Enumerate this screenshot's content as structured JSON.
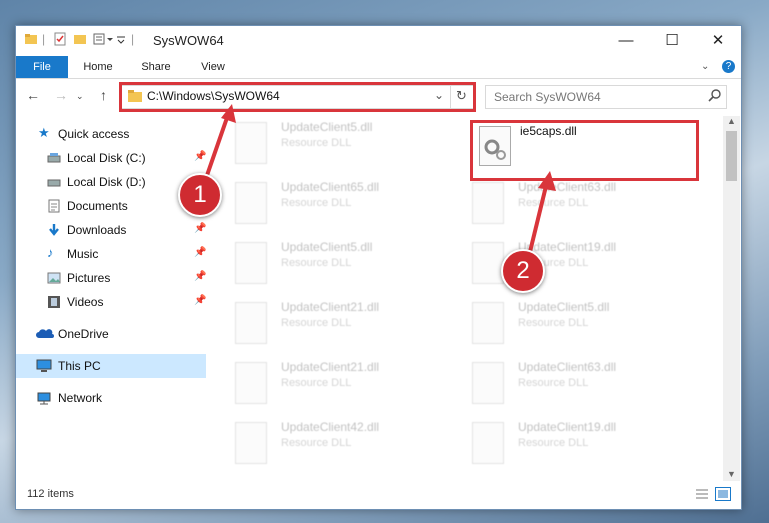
{
  "window": {
    "title": "SysWOW64"
  },
  "ribbon": {
    "tabs": [
      {
        "label": "File"
      },
      {
        "label": "Home"
      },
      {
        "label": "Share"
      },
      {
        "label": "View"
      }
    ]
  },
  "address": {
    "path": "C:\\Windows\\SysWOW64"
  },
  "search": {
    "placeholder": "Search SysWOW64"
  },
  "nav": {
    "items": [
      {
        "label": "Quick access"
      },
      {
        "label": "Local Disk (C:)"
      },
      {
        "label": "Local Disk (D:)"
      },
      {
        "label": "Documents"
      },
      {
        "label": "Downloads"
      },
      {
        "label": "Music"
      },
      {
        "label": "Pictures"
      },
      {
        "label": "Videos"
      },
      {
        "label": "OneDrive"
      },
      {
        "label": "This PC"
      },
      {
        "label": "Network"
      }
    ]
  },
  "files": {
    "left": [
      {
        "name": "UpdateClient5.dll",
        "type": "Resource DLL"
      },
      {
        "name": "UpdateClient65.dll",
        "type": "Resource DLL"
      },
      {
        "name": "UpdateClient5.dll",
        "type": "Resource DLL"
      },
      {
        "name": "UpdateClient21.dll",
        "type": "Resource DLL"
      },
      {
        "name": "UpdateClient21.dll",
        "type": "Resource DLL"
      },
      {
        "name": "UpdateClient42.dll",
        "type": "Resource DLL"
      }
    ],
    "right_highlight": {
      "name": "ie5caps.dll"
    },
    "right": [
      {
        "name": "UpdateClient63.dll",
        "type": "Resource DLL"
      },
      {
        "name": "UpdateClient19.dll",
        "type": "Resource DLL"
      },
      {
        "name": "UpdateClient5.dll",
        "type": "Resource DLL"
      },
      {
        "name": "UpdateClient63.dll",
        "type": "Resource DLL"
      },
      {
        "name": "UpdateClient19.dll",
        "type": "Resource DLL"
      }
    ]
  },
  "status": {
    "count": "112 items"
  },
  "annotations": {
    "step1": "1",
    "step2": "2"
  },
  "colors": {
    "accent": "#1979ca",
    "annotation": "#d9353b",
    "selection": "#cce8ff"
  }
}
